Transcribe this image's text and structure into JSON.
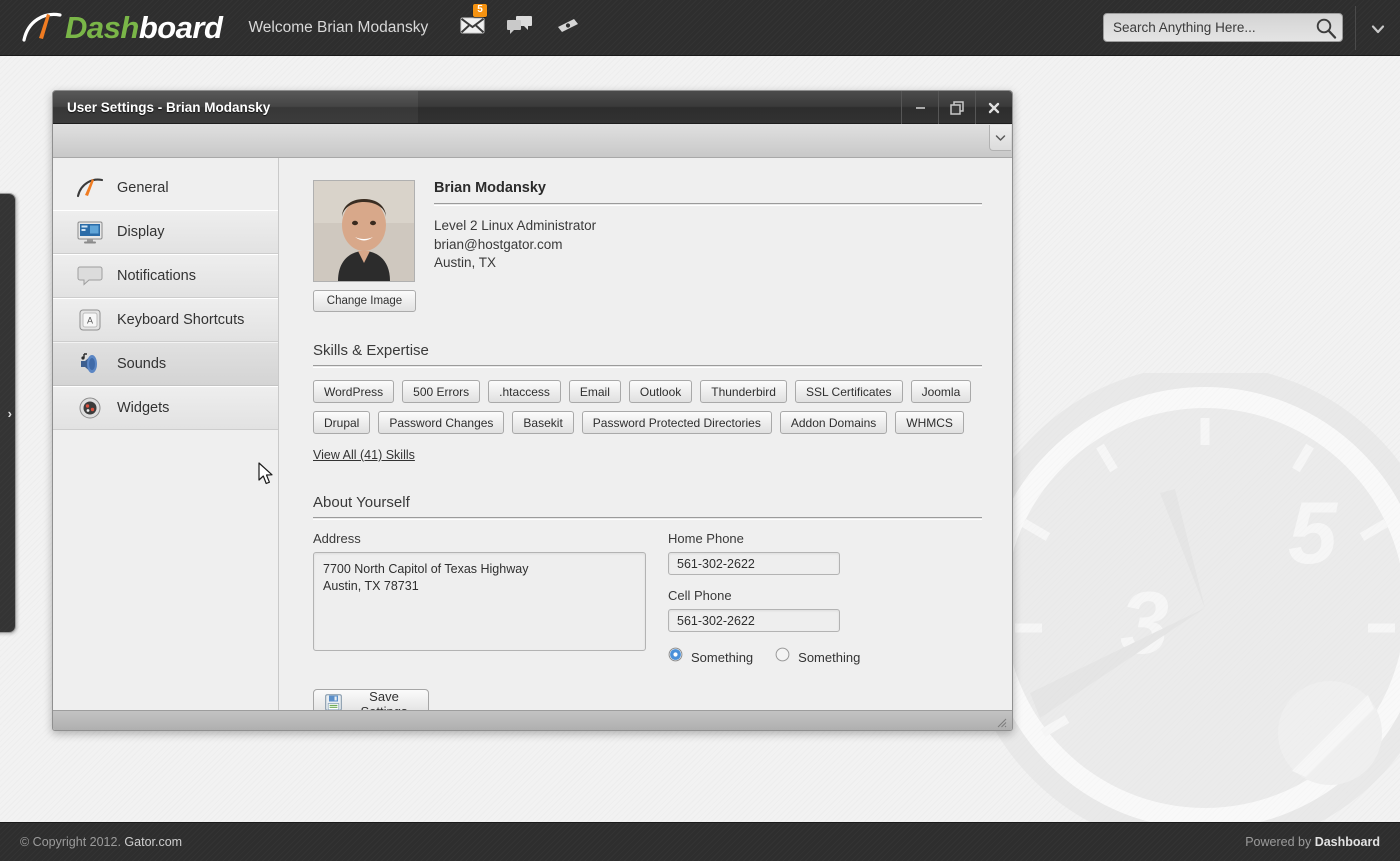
{
  "header": {
    "logo_dash": "Dash",
    "logo_board": "board",
    "logo_icon": "speedometer-needle-icon",
    "welcome": "Welcome Brian Modansky",
    "icons": [
      {
        "name": "mail-icon",
        "badge": "5"
      },
      {
        "name": "chat-icon",
        "badge": ""
      },
      {
        "name": "ticket-icon",
        "badge": ""
      }
    ],
    "search_placeholder": "Search Anything Here...",
    "search_value": "",
    "search_icon": "search-icon",
    "caret_icon": "chevron-down-icon"
  },
  "slide_tab": {
    "icon": "chevron-right-icon"
  },
  "window": {
    "title": "User Settings - Brian Modansky",
    "controls": {
      "minimize": "–",
      "restore": "restore-icon",
      "close": "✕",
      "toolbar_caret": "chevron-down-icon"
    }
  },
  "sidebar": {
    "items": [
      {
        "label": "General",
        "icon": "speedometer-icon",
        "state": "active"
      },
      {
        "label": "Display",
        "icon": "monitor-icon",
        "state": "normal"
      },
      {
        "label": "Notifications",
        "icon": "speech-bubble-icon",
        "state": "normal"
      },
      {
        "label": "Keyboard Shortcuts",
        "icon": "keyboard-key-icon",
        "state": "normal"
      },
      {
        "label": "Sounds",
        "icon": "speaker-icon",
        "state": "hover"
      },
      {
        "label": "Widgets",
        "icon": "widgets-orb-icon",
        "state": "normal"
      }
    ]
  },
  "profile": {
    "avatar_alt": "Brian Modansky profile photo",
    "change_image_label": "Change Image",
    "name": "Brian Modansky",
    "title": "Level 2 Linux Administrator",
    "email": "brian@hostgator.com",
    "location": "Austin, TX"
  },
  "skills": {
    "heading": "Skills & Expertise",
    "rows": [
      [
        "WordPress",
        "500 Errors",
        ".htaccess",
        "Email",
        "Outlook",
        "Thunderbird",
        "SSL Certificates",
        "Joomla"
      ],
      [
        "Drupal",
        "Password Changes",
        "Basekit",
        "Password Protected Directories",
        "Addon Domains",
        "WHMCS"
      ]
    ],
    "view_all": "View All (41) Skills"
  },
  "about": {
    "heading": "About Yourself",
    "address_label": "Address",
    "address_value": "7700 North Capitol of Texas Highway\nAustin, TX 78731",
    "home_phone_label": "Home Phone",
    "home_phone_value": "561-302-2622",
    "cell_phone_label": "Cell Phone",
    "cell_phone_value": "561-302-2622",
    "radio_one_label": "Something",
    "radio_two_label": "Something",
    "radio_selected": 1,
    "save_label": "Save Settings",
    "save_icon": "floppy-disk-icon"
  },
  "footer": {
    "copyright_prefix": "© Copyright 2012. ",
    "copyright_brand": "Gator.com",
    "powered_prefix": "Powered by ",
    "powered_brand": "Dashboard"
  },
  "watermark": {
    "icon": "speedometer-gauge-watermark",
    "numbers": [
      "3",
      "5"
    ]
  },
  "colors": {
    "accent_green": "#7ab648",
    "badge_orange": "#f59210",
    "dark_chrome": "#2e2e2e",
    "radio_blue": "#2f6fb5"
  }
}
